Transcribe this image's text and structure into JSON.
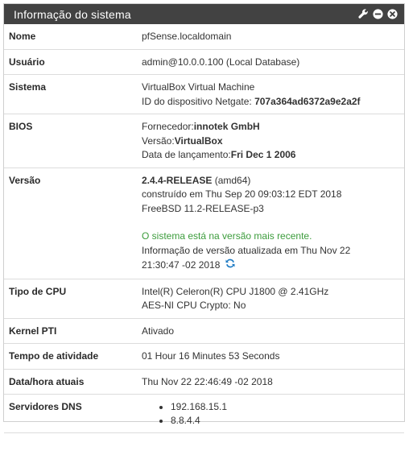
{
  "panel": {
    "title": "Informação do sistema",
    "icons": [
      "wrench-icon",
      "minus-circle-icon",
      "close-circle-icon"
    ]
  },
  "rows": {
    "name": {
      "label": "Nome",
      "value": "pfSense.localdomain"
    },
    "user": {
      "label": "Usuário",
      "value": "admin@10.0.0.100 (Local Database)"
    },
    "system": {
      "label": "Sistema",
      "line1": "VirtualBox Virtual Machine",
      "netgate_prefix": "ID do dispositivo Netgate: ",
      "netgate_id": "707a364ad6372a9e2a2f"
    },
    "bios": {
      "label": "BIOS",
      "vendor_prefix": "Fornecedor:",
      "vendor": "innotek GmbH",
      "version_prefix": "Versão:",
      "version": "VirtualBox",
      "date_prefix": "Data de lançamento:",
      "date": "Fri Dec 1 2006"
    },
    "version": {
      "label": "Versão",
      "release": "2.4.4-RELEASE",
      "arch": " (amd64)",
      "built": "construído em Thu Sep 20 09:03:12 EDT 2018",
      "freebsd": "FreeBSD 11.2-RELEASE-p3",
      "status": "O sistema está na versão mais recente.",
      "updated_line1": "Informação de versão atualizada em Thu Nov 22",
      "updated_line2": "21:30:47 -02 2018"
    },
    "cpu": {
      "label": "Tipo de CPU",
      "line1": "Intel(R) Celeron(R) CPU J1800 @ 2.41GHz",
      "line2": "AES-NI CPU Crypto: No"
    },
    "kernel_pti": {
      "label": "Kernel PTI",
      "value": "Ativado"
    },
    "uptime": {
      "label": "Tempo de atividade",
      "value": "01 Hour 16 Minutes 53 Seconds"
    },
    "datetime": {
      "label": "Data/hora atuais",
      "value": "Thu Nov 22 22:46:49 -02 2018"
    },
    "dns": {
      "label": "Servidores DNS",
      "servers": [
        "192.168.15.1",
        "8.8.4.4"
      ]
    }
  },
  "colors": {
    "header_bg": "#424242",
    "status_green": "#3c9c3c",
    "refresh_blue": "#1e7bc4"
  }
}
